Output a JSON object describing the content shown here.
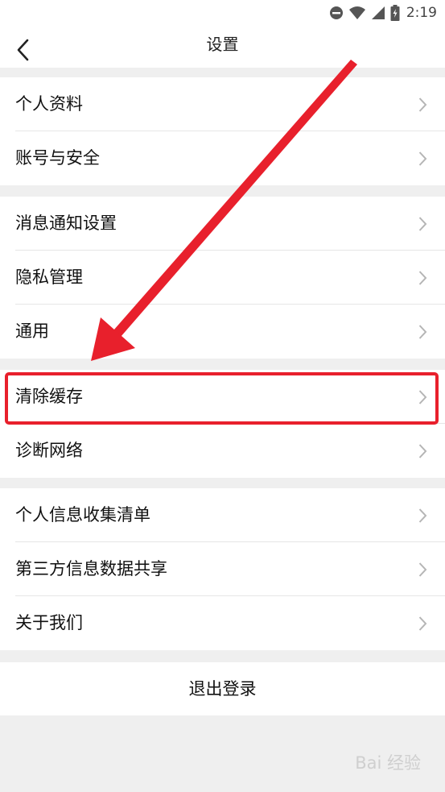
{
  "status_bar": {
    "time": "2:19",
    "icons": [
      "do-not-disturb-icon",
      "wifi-icon",
      "signal-icon",
      "battery-charging-icon"
    ]
  },
  "nav": {
    "title": "设置",
    "back_icon": "chevron-left-icon"
  },
  "groups": [
    {
      "items": [
        {
          "label": "个人资料"
        },
        {
          "label": "账号与安全"
        }
      ]
    },
    {
      "items": [
        {
          "label": "消息通知设置"
        },
        {
          "label": "隐私管理"
        },
        {
          "label": "通用"
        }
      ]
    },
    {
      "items": [
        {
          "label": "清除缓存"
        },
        {
          "label": "诊断网络"
        }
      ]
    },
    {
      "items": [
        {
          "label": "个人信息收集清单"
        },
        {
          "label": "第三方信息数据共享"
        },
        {
          "label": "关于我们"
        }
      ]
    }
  ],
  "logout_label": "退出登录",
  "annotation": {
    "highlighted_item": "清除缓存",
    "color": "#e8202c"
  },
  "watermark": "Bai 经验",
  "colors": {
    "page_background": "#efefef",
    "card_background": "#ffffff",
    "accent_annotation": "#e8202c"
  }
}
